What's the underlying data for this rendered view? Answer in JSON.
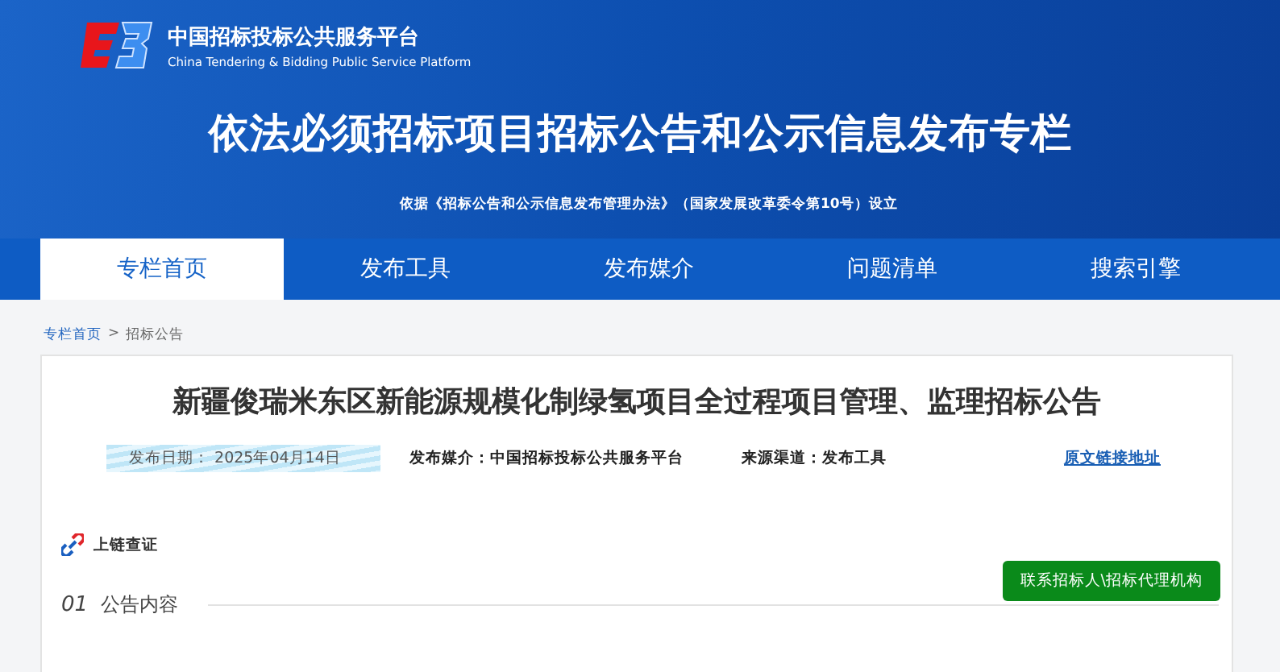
{
  "header": {
    "platform_name": "中国招标投标公共服务平台",
    "platform_name_en": "China Tendering & Bidding Public Service Platform",
    "banner_title": "依法必须招标项目招标公告和公示信息发布专栏",
    "basis": "依据《招标公告和公示信息发布管理办法》（国家发展改革委令第10号）设立"
  },
  "nav": [
    {
      "label": "专栏首页",
      "selected": true
    },
    {
      "label": "发布工具",
      "selected": false
    },
    {
      "label": "发布媒介",
      "selected": false
    },
    {
      "label": "问题清单",
      "selected": false
    },
    {
      "label": "搜索引擎",
      "selected": false
    }
  ],
  "breadcrumb": {
    "home": "专栏首页",
    "separator": ">",
    "current": "招标公告"
  },
  "notice": {
    "title": "新疆俊瑞米东区新能源规模化制绿氢项目全过程项目管理、监理招标公告",
    "date_label": "发布日期：",
    "date": "2025年04月14日",
    "media_label": "发布媒介：",
    "media": "中国招标投标公共服务平台",
    "source_label": "来源渠道：",
    "source": "发布工具",
    "link": "原文链接地址",
    "chain": "上链查证",
    "contact_button": "联系招标人\\招标代理机构",
    "section_number": "01",
    "section_title": "公告内容"
  }
}
